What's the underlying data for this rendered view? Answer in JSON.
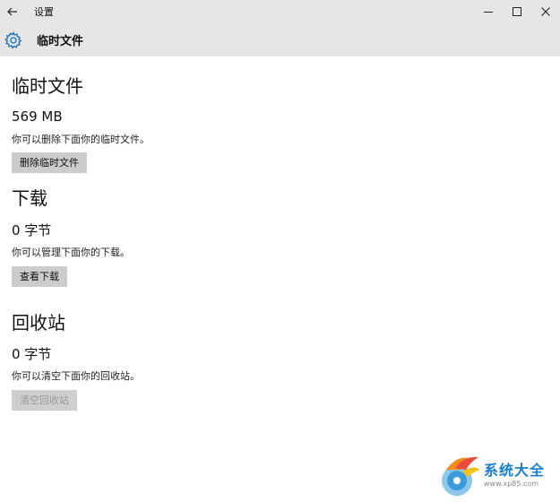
{
  "window": {
    "title": "设置"
  },
  "header": {
    "title": "临时文件"
  },
  "sections": [
    {
      "title": "临时文件",
      "size": "569 MB",
      "description": "你可以删除下面你的临时文件。",
      "button_label": "删除临时文件",
      "button_enabled": true
    },
    {
      "title": "下载",
      "size": "0 字节",
      "description": "你可以管理下面你的下载。",
      "button_label": "查看下载",
      "button_enabled": true
    },
    {
      "title": "回收站",
      "size": "0 字节",
      "description": "你可以清空下面你的回收站。",
      "button_label": "清空回收站",
      "button_enabled": false
    }
  ],
  "watermark": {
    "title": "系统大全",
    "url": "www.xp85.com"
  },
  "icons": {
    "back": "back-arrow-icon",
    "header": "gear-icon",
    "minimize": "minimize-icon",
    "maximize": "maximize-icon",
    "close": "close-icon"
  },
  "colors": {
    "chrome_background": "#e6e6e6",
    "button_background": "#cccccc",
    "disabled_text": "#999999",
    "accent": "#1a7fc8"
  }
}
